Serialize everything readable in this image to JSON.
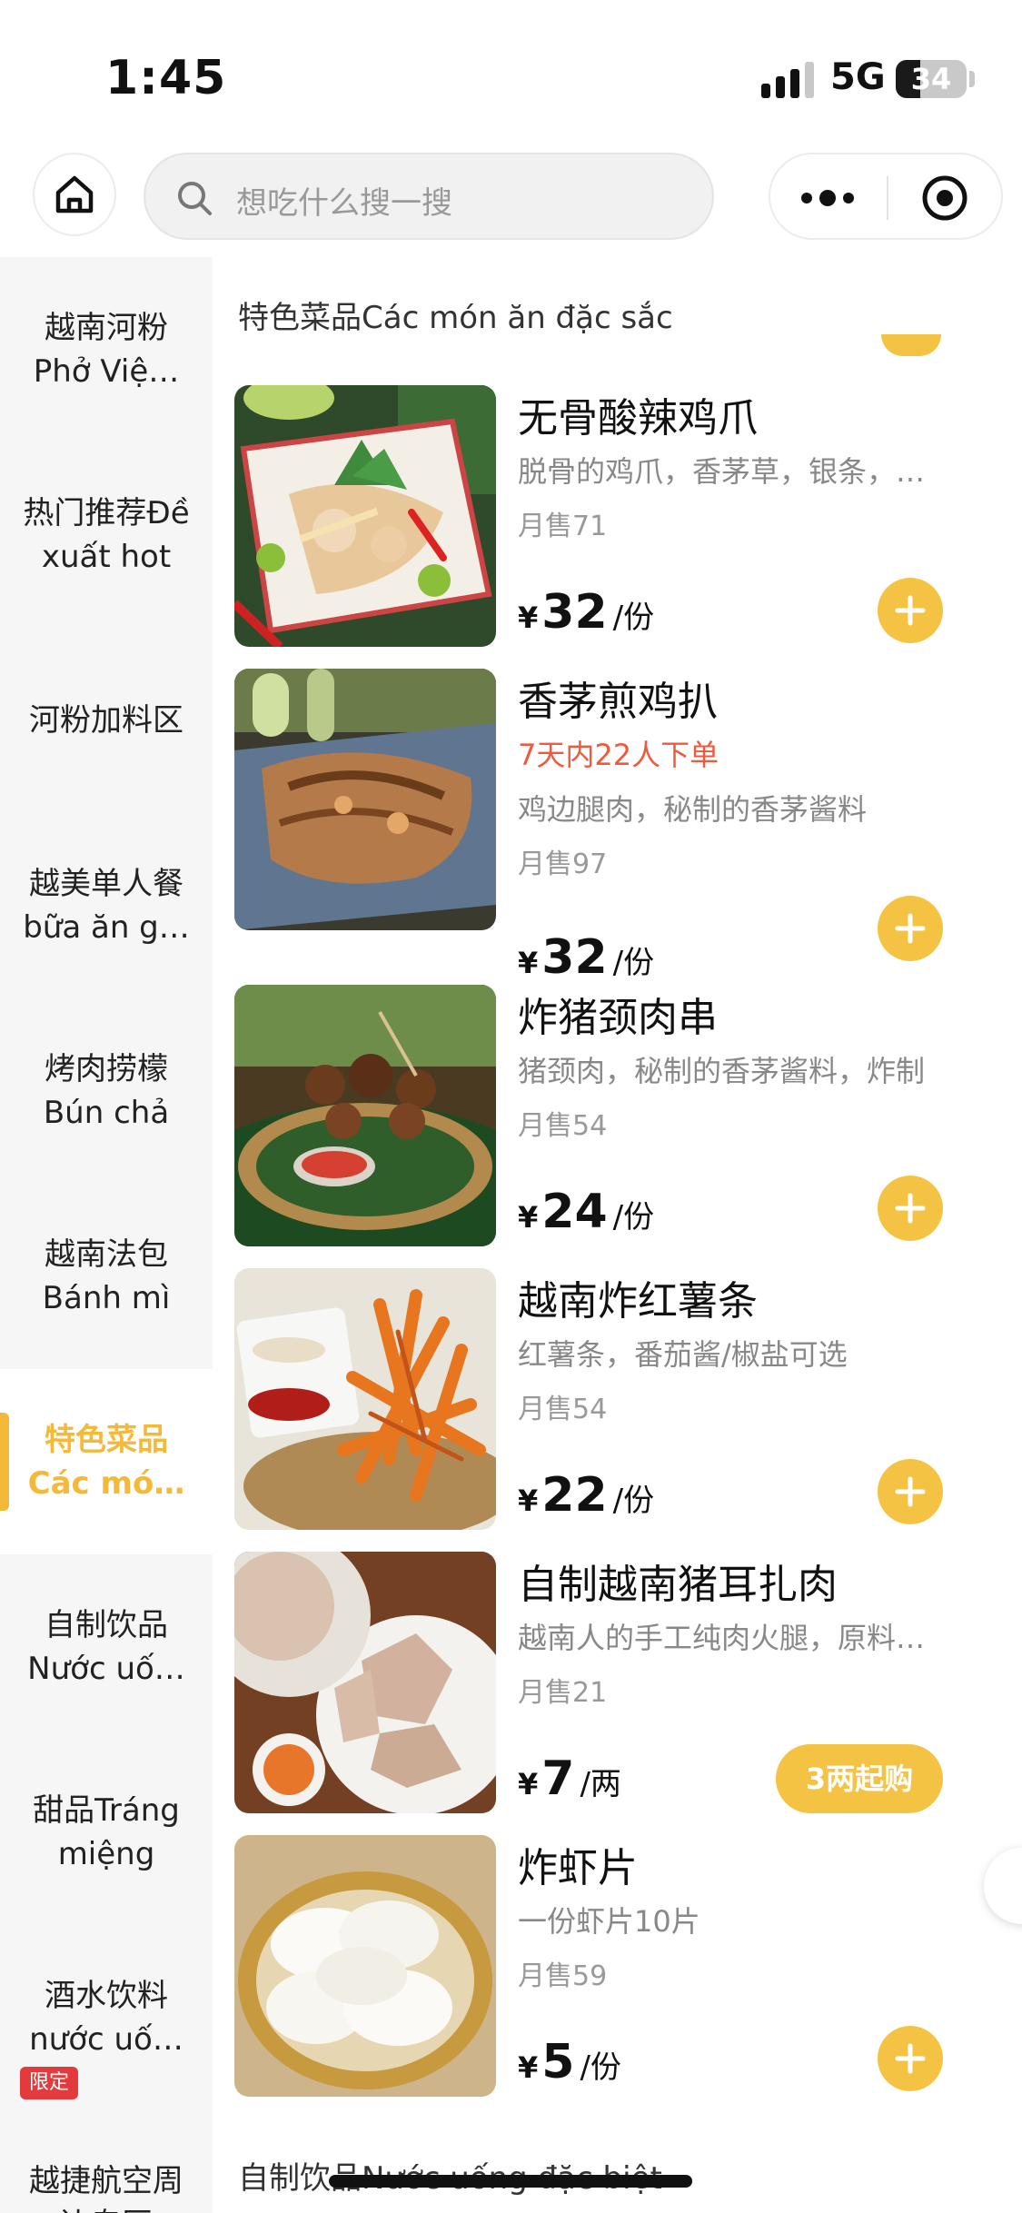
{
  "status_bar": {
    "time": "1:45",
    "network": "5G",
    "battery": "34",
    "battery_level": 0.34
  },
  "top_nav": {
    "search_placeholder": "想吃什么搜一搜"
  },
  "sidebar": {
    "items": [
      {
        "label": "越南河粉\nPhở Việ…",
        "active": false
      },
      {
        "label": "热门推荐Đề\nxuất hot",
        "active": false
      },
      {
        "label": "河粉加料区",
        "active": false
      },
      {
        "label": "越美单人餐\nbữa ăn g…",
        "active": false
      },
      {
        "label": "烤肉捞檬\nBún chả",
        "active": false
      },
      {
        "label": "越南法包\nBánh mì",
        "active": false
      },
      {
        "label": "特色菜品\nCác mó…",
        "active": true
      },
      {
        "label": "自制饮品\nNước uố…",
        "active": false
      },
      {
        "label": "甜品Tráng\nmiệng",
        "active": false
      },
      {
        "label": "酒水饮料\nnước uố…",
        "active": false
      },
      {
        "label": "越捷航空周\n边专区",
        "active": false
      }
    ],
    "badge": "限定"
  },
  "section_title": "特色菜品Các món ăn đặc sắc",
  "next_section_title": "自制饮品Nước uống đặc biệt",
  "items": [
    {
      "name": "无骨酸辣鸡爪",
      "desc": "脱骨的鸡爪，香茅草，银条，…",
      "promo": "",
      "sales": "月售71",
      "currency": "¥",
      "price": "32",
      "unit": "/份",
      "action": "add"
    },
    {
      "name": "香茅煎鸡扒",
      "desc": "鸡边腿肉，秘制的香茅酱料",
      "promo": "7天内22人下单",
      "sales": "月售97",
      "currency": "¥",
      "price": "32",
      "unit": "/份",
      "action": "add"
    },
    {
      "name": "炸猪颈肉串",
      "desc": "猪颈肉，秘制的香茅酱料，炸制",
      "promo": "",
      "sales": "月售54",
      "currency": "¥",
      "price": "24",
      "unit": "/份",
      "action": "add"
    },
    {
      "name": "越南炸红薯条",
      "desc": "红薯条，番茄酱/椒盐可选",
      "promo": "",
      "sales": "月售54",
      "currency": "¥",
      "price": "22",
      "unit": "/份",
      "action": "add"
    },
    {
      "name": "自制越南猪耳扎肉",
      "desc": "越南人的手工纯肉火腿，原料…",
      "promo": "",
      "sales": "月售21",
      "currency": "¥",
      "price": "7",
      "unit": "/两",
      "action": "min",
      "min_label": "3两起购"
    },
    {
      "name": "炸虾片",
      "desc": "一份虾片10片",
      "promo": "",
      "sales": "月售59",
      "currency": "¥",
      "price": "5",
      "unit": "/份",
      "action": "add"
    }
  ],
  "colors": {
    "accent": "#f5c344",
    "active_text": "#f5b93a",
    "promo": "#f2583e",
    "badge": "#e33b3b"
  }
}
